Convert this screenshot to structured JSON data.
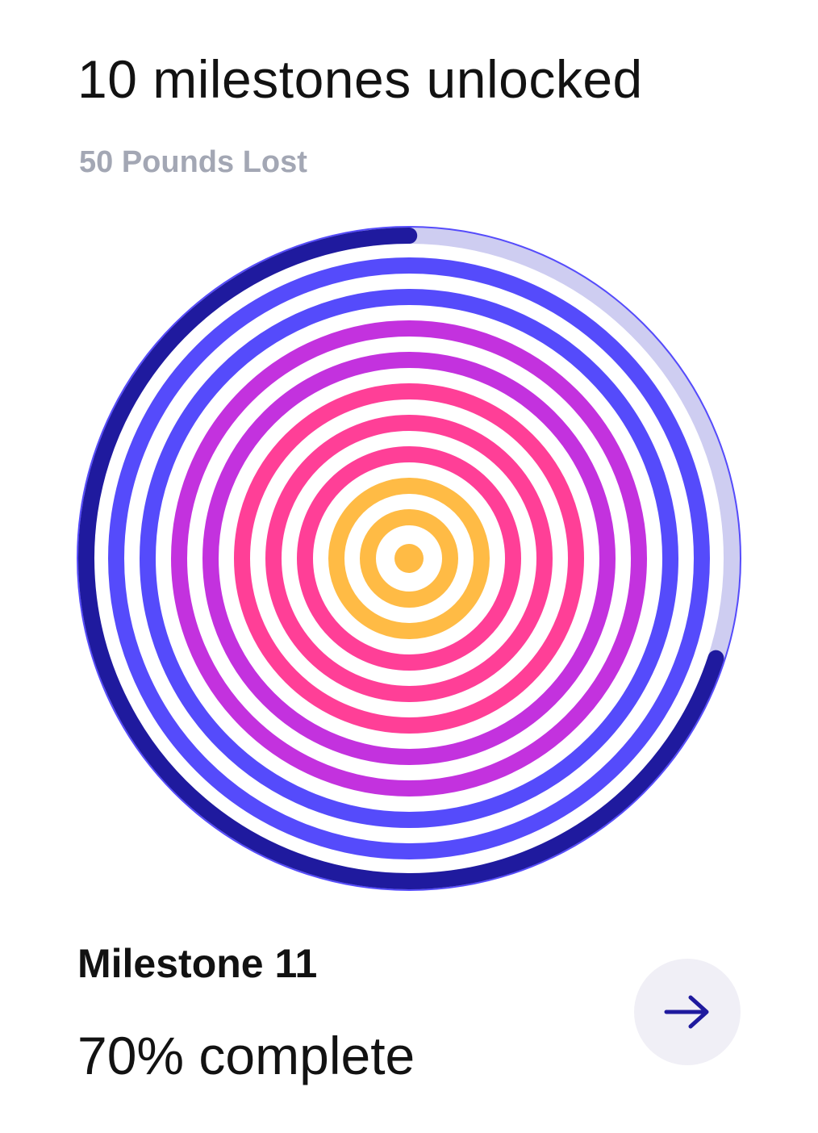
{
  "header": {
    "title": "10 milestones unlocked",
    "subtitle": "50 Pounds Lost"
  },
  "rings": {
    "unlocked_count": 10,
    "current_progress": 0.7,
    "items": [
      {
        "color": "#ffbb45"
      },
      {
        "color": "#ffbb45"
      },
      {
        "color": "#ff3f97"
      },
      {
        "color": "#ff3f97"
      },
      {
        "color": "#ff3f97"
      },
      {
        "color": "#c332de"
      },
      {
        "color": "#c332de"
      },
      {
        "color": "#554bfb"
      },
      {
        "color": "#554bfb"
      },
      {
        "color": "#554bfb"
      }
    ],
    "center_dot_color": "#ffbb45",
    "current_ring_color": "#1f1a9e",
    "track_color": "#cecdf1"
  },
  "milestone": {
    "title": "Milestone 11",
    "progress_text": "70% complete"
  },
  "next_button": {
    "icon": "arrow-right-icon",
    "icon_color": "#1f1a9e",
    "background": "#f0eff6"
  }
}
